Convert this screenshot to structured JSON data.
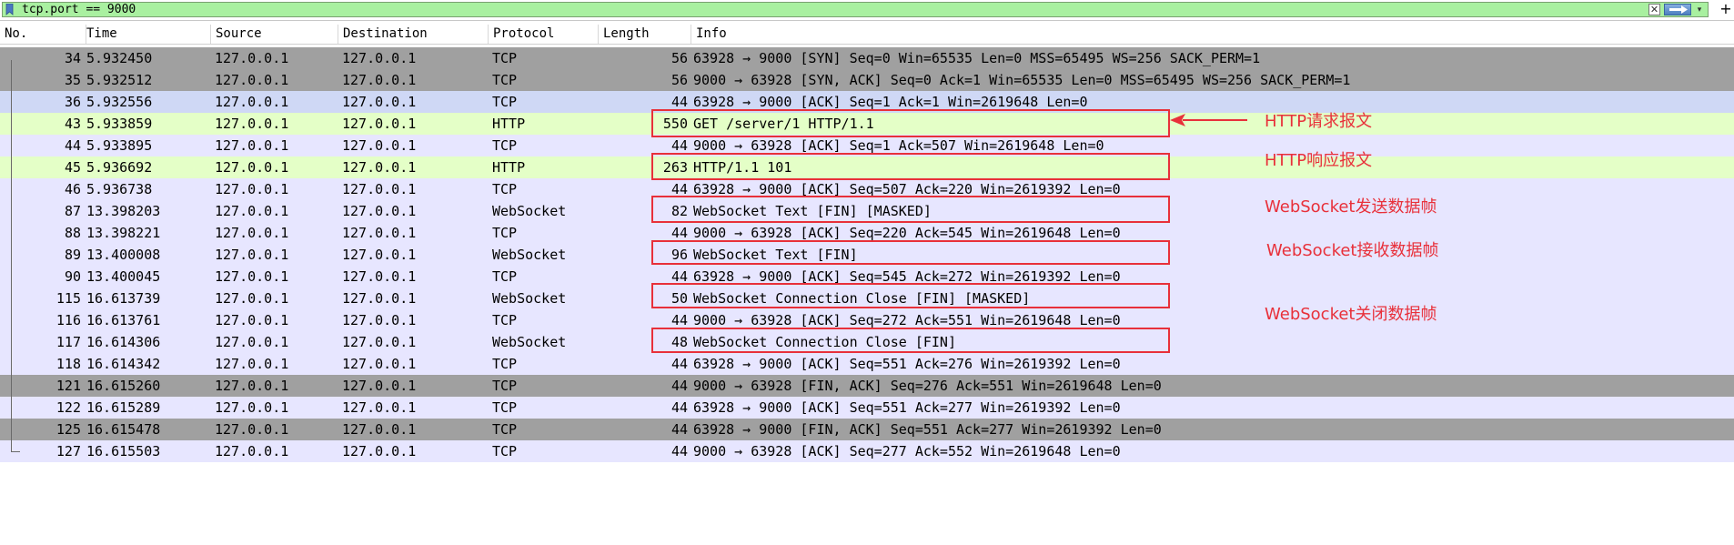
{
  "filter": {
    "text": "tcp.port == 9000",
    "clear_label": "✕",
    "dropdown_label": "▾",
    "add_label": "+"
  },
  "columns": [
    "No.",
    "Time",
    "Source",
    "Destination",
    "Protocol",
    "Length",
    "Info"
  ],
  "colors": {
    "tcp_syn_fin": "#a0a0a0",
    "tcp_normal": "#e7e6ff",
    "http": "#e4ffc7",
    "selected": "#cfd8f5",
    "annotation": "#e8303a",
    "filter_bg": "#a9f0a0"
  },
  "packets": [
    {
      "no": "34",
      "time": "5.932450",
      "source": "127.0.0.1",
      "destination": "127.0.0.1",
      "protocol": "TCP",
      "length": "56",
      "info": "63928 → 9000 [SYN] Seq=0 Win=65535 Len=0 MSS=65495 WS=256 SACK_PERM=1",
      "style": "gray"
    },
    {
      "no": "35",
      "time": "5.932512",
      "source": "127.0.0.1",
      "destination": "127.0.0.1",
      "protocol": "TCP",
      "length": "56",
      "info": "9000 → 63928 [SYN, ACK] Seq=0 Ack=1 Win=65535 Len=0 MSS=65495 WS=256 SACK_PERM=1",
      "style": "gray"
    },
    {
      "no": "36",
      "time": "5.932556",
      "source": "127.0.0.1",
      "destination": "127.0.0.1",
      "protocol": "TCP",
      "length": "44",
      "info": "63928 → 9000 [ACK] Seq=1 Ack=1 Win=2619648 Len=0",
      "style": "selected"
    },
    {
      "no": "43",
      "time": "5.933859",
      "source": "127.0.0.1",
      "destination": "127.0.0.1",
      "protocol": "HTTP",
      "length": "550",
      "info": "GET /server/1 HTTP/1.1",
      "style": "http"
    },
    {
      "no": "44",
      "time": "5.933895",
      "source": "127.0.0.1",
      "destination": "127.0.0.1",
      "protocol": "TCP",
      "length": "44",
      "info": "9000 → 63928 [ACK] Seq=1 Ack=507 Win=2619648 Len=0",
      "style": "tcp"
    },
    {
      "no": "45",
      "time": "5.936692",
      "source": "127.0.0.1",
      "destination": "127.0.0.1",
      "protocol": "HTTP",
      "length": "263",
      "info": "HTTP/1.1 101",
      "style": "http"
    },
    {
      "no": "46",
      "time": "5.936738",
      "source": "127.0.0.1",
      "destination": "127.0.0.1",
      "protocol": "TCP",
      "length": "44",
      "info": "63928 → 9000 [ACK] Seq=507 Ack=220 Win=2619392 Len=0",
      "style": "tcp"
    },
    {
      "no": "87",
      "time": "13.398203",
      "source": "127.0.0.1",
      "destination": "127.0.0.1",
      "protocol": "WebSocket",
      "length": "82",
      "info": "WebSocket Text [FIN] [MASKED]",
      "style": "tcp"
    },
    {
      "no": "88",
      "time": "13.398221",
      "source": "127.0.0.1",
      "destination": "127.0.0.1",
      "protocol": "TCP",
      "length": "44",
      "info": "9000 → 63928 [ACK] Seq=220 Ack=545 Win=2619648 Len=0",
      "style": "tcp"
    },
    {
      "no": "89",
      "time": "13.400008",
      "source": "127.0.0.1",
      "destination": "127.0.0.1",
      "protocol": "WebSocket",
      "length": "96",
      "info": "WebSocket Text [FIN]",
      "style": "tcp"
    },
    {
      "no": "90",
      "time": "13.400045",
      "source": "127.0.0.1",
      "destination": "127.0.0.1",
      "protocol": "TCP",
      "length": "44",
      "info": "63928 → 9000 [ACK] Seq=545 Ack=272 Win=2619392 Len=0",
      "style": "tcp"
    },
    {
      "no": "115",
      "time": "16.613739",
      "source": "127.0.0.1",
      "destination": "127.0.0.1",
      "protocol": "WebSocket",
      "length": "50",
      "info": "WebSocket Connection Close [FIN] [MASKED]",
      "style": "tcp"
    },
    {
      "no": "116",
      "time": "16.613761",
      "source": "127.0.0.1",
      "destination": "127.0.0.1",
      "protocol": "TCP",
      "length": "44",
      "info": "9000 → 63928 [ACK] Seq=272 Ack=551 Win=2619648 Len=0",
      "style": "tcp"
    },
    {
      "no": "117",
      "time": "16.614306",
      "source": "127.0.0.1",
      "destination": "127.0.0.1",
      "protocol": "WebSocket",
      "length": "48",
      "info": "WebSocket Connection Close [FIN]",
      "style": "tcp"
    },
    {
      "no": "118",
      "time": "16.614342",
      "source": "127.0.0.1",
      "destination": "127.0.0.1",
      "protocol": "TCP",
      "length": "44",
      "info": "63928 → 9000 [ACK] Seq=551 Ack=276 Win=2619392 Len=0",
      "style": "tcp"
    },
    {
      "no": "121",
      "time": "16.615260",
      "source": "127.0.0.1",
      "destination": "127.0.0.1",
      "protocol": "TCP",
      "length": "44",
      "info": "9000 → 63928 [FIN, ACK] Seq=276 Ack=551 Win=2619648 Len=0",
      "style": "gray"
    },
    {
      "no": "122",
      "time": "16.615289",
      "source": "127.0.0.1",
      "destination": "127.0.0.1",
      "protocol": "TCP",
      "length": "44",
      "info": "63928 → 9000 [ACK] Seq=551 Ack=277 Win=2619392 Len=0",
      "style": "tcp"
    },
    {
      "no": "125",
      "time": "16.615478",
      "source": "127.0.0.1",
      "destination": "127.0.0.1",
      "protocol": "TCP",
      "length": "44",
      "info": "63928 → 9000 [FIN, ACK] Seq=551 Ack=277 Win=2619392 Len=0",
      "style": "gray"
    },
    {
      "no": "127",
      "time": "16.615503",
      "source": "127.0.0.1",
      "destination": "127.0.0.1",
      "protocol": "TCP",
      "length": "44",
      "info": "9000 → 63928 [ACK] Seq=277 Ack=552 Win=2619648 Len=0",
      "style": "tcp"
    }
  ],
  "annotations": {
    "http_request": "HTTP请求报文",
    "http_response": "HTTP响应报文",
    "ws_send": "WebSocket发送数据帧",
    "ws_receive": "WebSocket接收数据帧",
    "ws_close": "WebSocket关闭数据帧"
  }
}
